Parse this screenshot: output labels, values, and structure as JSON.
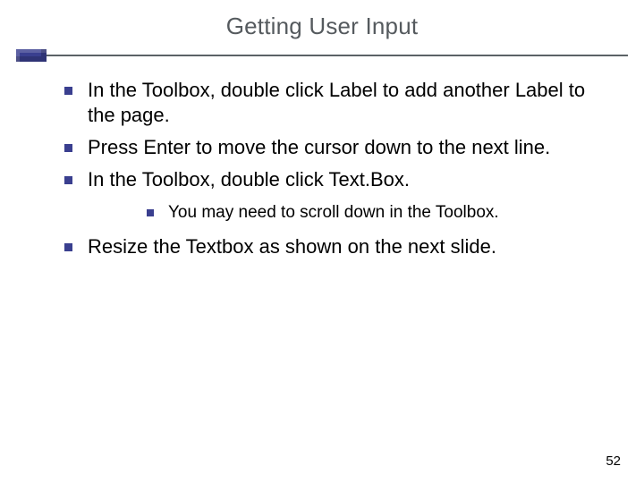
{
  "slide": {
    "title": "Getting User Input",
    "page_number": "52",
    "bullets": [
      {
        "text": "In the Toolbox, double click Label to add another Label to the page."
      },
      {
        "text": "Press Enter to move the cursor down to the next line."
      },
      {
        "text": "In the Toolbox, double click Text.Box.",
        "sub": [
          {
            "text": "You may need to scroll down in the Toolbox."
          }
        ]
      },
      {
        "text": "Resize the Textbox as shown on the next slide."
      }
    ]
  }
}
